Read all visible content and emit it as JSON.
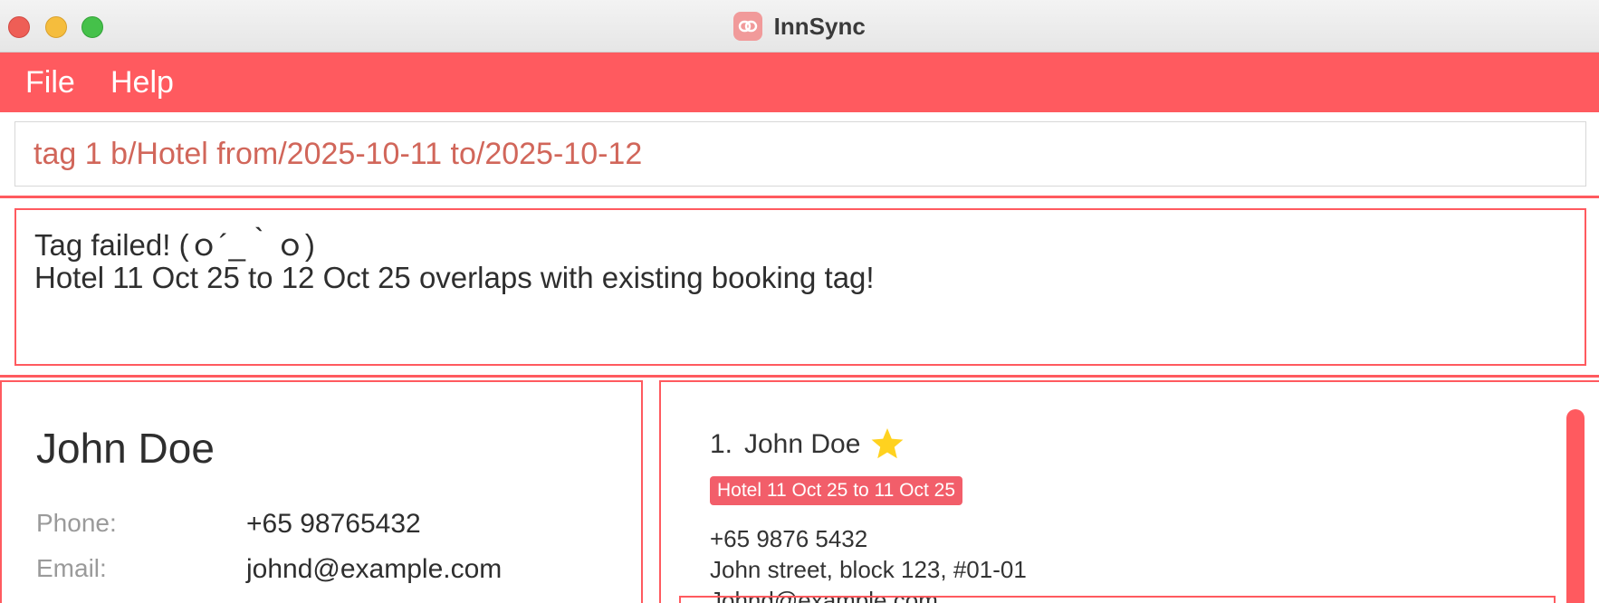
{
  "window": {
    "title": "InnSync",
    "accent_color": "#ff5a5f"
  },
  "menu": {
    "file_label": "File",
    "help_label": "Help"
  },
  "command": {
    "value": "tag 1 b/Hotel from/2025-10-11 to/2025-10-12"
  },
  "result": {
    "line1": "Tag failed! (ｏ´_｀ｏ)",
    "line2": "Hotel 11 Oct 25 to 12 Oct 25 overlaps with existing booking tag!"
  },
  "detail": {
    "name": "John Doe",
    "phone_label": "Phone:",
    "phone_value": "+65 98765432",
    "email_label": "Email:",
    "email_value": "johnd@example.com"
  },
  "list": {
    "items": [
      {
        "index": "1.",
        "name": "John Doe",
        "starred": true,
        "tag": "Hotel 11 Oct 25 to 11 Oct 25",
        "phone": "+65 9876 5432",
        "address": "John street, block 123, #01-01",
        "email": "Johnd@example.com"
      }
    ]
  },
  "icons": {
    "app": "innsync-logo-icon",
    "star": "star-icon"
  }
}
